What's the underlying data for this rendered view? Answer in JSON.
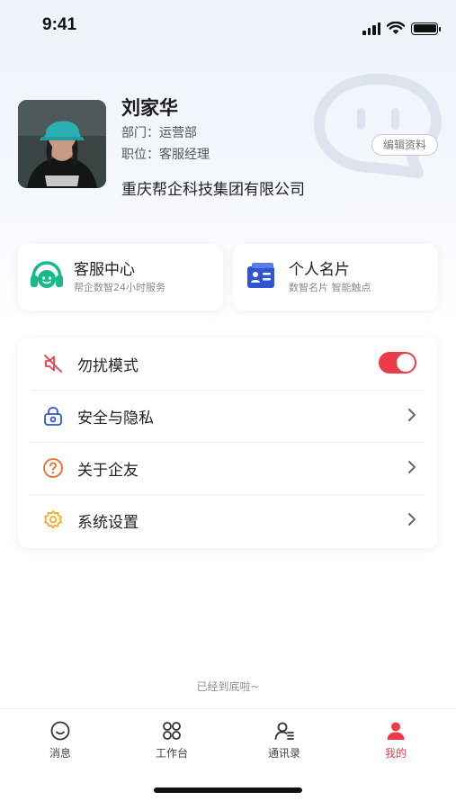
{
  "status_bar": {
    "time": "9:41"
  },
  "profile": {
    "name": "刘家华",
    "department": "部门：运营部",
    "position": "职位：客服经理",
    "company": "重庆帮企科技集团有限公司",
    "edit_label": "编辑资料"
  },
  "cards": [
    {
      "title": "客服中心",
      "subtitle": "帮企数智24小时服务",
      "icon": "headset-icon",
      "color": "#19b98a"
    },
    {
      "title": "个人名片",
      "subtitle": "数智名片  智能触点",
      "icon": "id-card-icon",
      "color": "#2f55d4"
    }
  ],
  "settings": [
    {
      "label": "勿扰模式",
      "icon": "mute-icon",
      "color": "#ee3b48",
      "control": "toggle",
      "enabled": true
    },
    {
      "label": "安全与隐私",
      "icon": "lock-icon",
      "color": "#2f55d4",
      "control": "chevron"
    },
    {
      "label": "关于企友",
      "icon": "question-icon",
      "color": "#f26b21",
      "control": "chevron"
    },
    {
      "label": "系统设置",
      "icon": "gear-icon",
      "color": "#f5a623",
      "control": "chevron"
    }
  ],
  "footer_note": "已经到底啦~",
  "tabbar": {
    "items": [
      {
        "label": "消息",
        "icon": "message-icon",
        "active": false
      },
      {
        "label": "工作台",
        "icon": "workbench-icon",
        "active": false
      },
      {
        "label": "通讯录",
        "icon": "contacts-icon",
        "active": false
      },
      {
        "label": "我的",
        "icon": "profile-icon",
        "active": true
      }
    ],
    "active_color": "#ee3b48"
  }
}
